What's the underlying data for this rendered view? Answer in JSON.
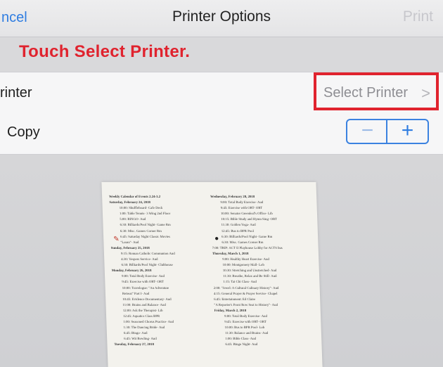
{
  "navbar": {
    "cancel_label": "ncel",
    "title": "Printer Options",
    "print_label": "Print"
  },
  "hint": "Touch Select Printer.",
  "printer_row": {
    "label": "rinter",
    "select_label": "Select Printer",
    "chevron": ">"
  },
  "copy_row": {
    "label": "Copy",
    "minus": "−",
    "plus": "+"
  },
  "colors": {
    "accent": "#2f7de1",
    "highlight": "#e0232e"
  },
  "preview": {
    "left": [
      {
        "t": "Weekly Calendar of Events 2.24-3.2",
        "c": "head"
      },
      {
        "t": "Saturday, February 24, 2018",
        "c": "head"
      },
      {
        "t": "10:00: Shuffleboard- Cafe Deck",
        "c": "ind"
      },
      {
        "t": "1:00: Table Tennis- 3 Wing 2nd Floor",
        "c": "ind"
      },
      {
        "t": "5:00: BINGO- Aud",
        "c": "ind"
      },
      {
        "t": "6:30: Billiards/Pool Night- Game Rm",
        "c": "ind"
      },
      {
        "t": "6:30: Misc. Games Corner Rm",
        "c": "ind"
      },
      {
        "t": "6:45: Saturday Night Classic Movies",
        "c": "ind"
      },
      {
        "t": "\"Laura\"- Aud",
        "c": "ind"
      },
      {
        "t": "Sunday, February 25, 2018",
        "c": "head"
      },
      {
        "t": "9:15: Roman Catholic Communion Aud",
        "c": "ind"
      },
      {
        "t": "4:30: Vespers Service- Aud",
        "c": "ind"
      },
      {
        "t": "6:30: Billiards/Pool Night- Clubhouse",
        "c": "ind"
      },
      {
        "t": "Monday, February 26, 2018",
        "c": "head"
      },
      {
        "t": "9:00: Total Body Exercise- Aud",
        "c": "ind"
      },
      {
        "t": "9:45: Exercise with ORT- ORT",
        "c": "ind"
      },
      {
        "t": "10:00: Travelogue: \"An Adventure",
        "c": "ind"
      },
      {
        "t": "Retreat\" Part I- Aud",
        "c": "ind"
      },
      {
        "t": "10:45: Evidence Documentary- Aud",
        "c": "ind"
      },
      {
        "t": "11:00: Brains and Balance- Aud",
        "c": "ind"
      },
      {
        "t": "12:00: Ask the Therapist- Lib",
        "c": "ind"
      },
      {
        "t": "12:45: Aquatics Class BPR",
        "c": "ind"
      },
      {
        "t": "1:00: Seasoned Chorus Practice- Aud",
        "c": "ind"
      },
      {
        "t": "1:30: The Dancing Bride- Aud",
        "c": "ind"
      },
      {
        "t": "6:45: Bingo- Aud",
        "c": "ind"
      },
      {
        "t": "6:45: Wii Bowling- Aud",
        "c": "ind"
      },
      {
        "t": "Tuesday, February 27, 2018",
        "c": "head"
      }
    ],
    "right": [
      {
        "t": "Wednesday, February 28, 2018",
        "c": "head"
      },
      {
        "t": "9:00: Total Body Exercise- Aud",
        "c": "ind"
      },
      {
        "t": "9:45: Exercise with ORT- ORT",
        "c": "ind"
      },
      {
        "t": "10:00: Senator Greenleaf's Office- Lib",
        "c": "ind"
      },
      {
        "t": "10:15: Bible Study and Hymn Sing- ORT",
        "c": "ind"
      },
      {
        "t": "11:30: Golden Yoga- Aud",
        "c": "ind"
      },
      {
        "t": "12:45: Bus to BPR Pool",
        "c": "ind"
      },
      {
        "t": "6:30: Billiards/Pool Night- Game Rm",
        "c": "ind"
      },
      {
        "t": "6:30: Misc. Games Corner Rm",
        "c": "ind"
      },
      {
        "t": "7:00: TRIP: ACT II Playhouse Lobby for ACTS bus",
        "c": ""
      },
      {
        "t": "Thursday, March 1, 2018",
        "c": "head"
      },
      {
        "t": "9:00: Healthy Heart Exercise- Aud",
        "c": "ind"
      },
      {
        "t": "10:00: Montgomery Mall- Lob",
        "c": "ind"
      },
      {
        "t": "10:30: Stretching and Unstretched- Aud",
        "c": "ind"
      },
      {
        "t": "11:30: Breathe, Relax and Be Still- Aud",
        "c": "ind"
      },
      {
        "t": "1:15: Tai Chi Class- Aud",
        "c": "ind"
      },
      {
        "t": "2:00: \"Jewel: A Cultural Culinary History\"- Aud",
        "c": ""
      },
      {
        "t": "4:15: General Prayer & Prayer Service- Chapel",
        "c": ""
      },
      {
        "t": "6:45: Entertainment: Ed Claire",
        "c": ""
      },
      {
        "t": "\"A Reporter's Front Row Seat to History\"- Aud",
        "c": ""
      },
      {
        "t": "Friday, March 2, 2018",
        "c": "head"
      },
      {
        "t": "9:00: Total Body Exercise- Aud",
        "c": "ind"
      },
      {
        "t": "9:45: Exercise with ORT- ORT",
        "c": "ind"
      },
      {
        "t": "10:00: Bus to BPR Pool- Lob",
        "c": "ind"
      },
      {
        "t": "11:30: Balance and Brains- Aud",
        "c": "ind"
      },
      {
        "t": "1:00: Bible Class- Aud",
        "c": "ind"
      },
      {
        "t": "6:45: Bingo Night- Aud",
        "c": "ind"
      }
    ]
  }
}
